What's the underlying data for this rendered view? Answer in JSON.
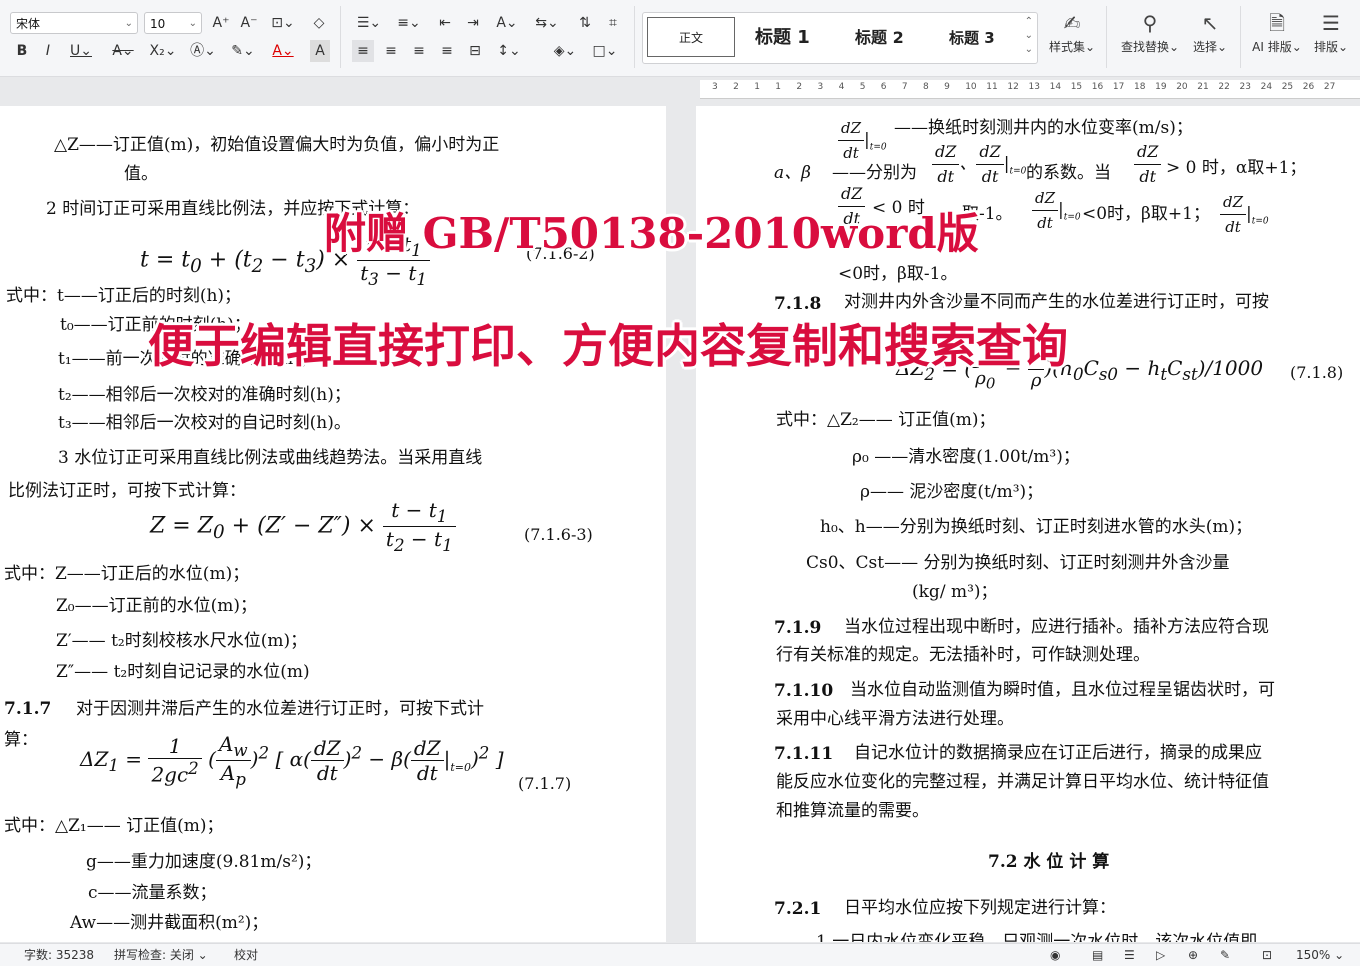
{
  "toolbar": {
    "font_name": "宋体",
    "font_size": "10",
    "styles": [
      "正文",
      "标题 1",
      "标题 2",
      "标题 3"
    ],
    "style_set_label": "样式集",
    "find_replace_label": "查找替换",
    "select_label": "选择",
    "ai_layout_label": "AI 排版",
    "layout_label": "排版"
  },
  "ruler": {
    "ticks": [
      "3",
      "2",
      "1",
      "1",
      "2",
      "3",
      "4",
      "5",
      "6",
      "7",
      "8",
      "9",
      "10",
      "11",
      "12",
      "13",
      "14",
      "15",
      "16",
      "17",
      "18",
      "19",
      "20",
      "21",
      "22",
      "23",
      "24",
      "25",
      "26",
      "27"
    ]
  },
  "banner": {
    "line1": "附赠 GB/T50138-2010word版",
    "line2": "便于编辑直接打印、方便内容复制和搜索查询"
  },
  "left_page": {
    "l1": "△Z——订正值(m)，初始值设置偏大时为负值，偏小时为正",
    "l2": "值。",
    "l3": "2 时间订正可采用直线比例法，并应按下式计算：",
    "eq2_no": "(7.1.6-2)",
    "l4": "式中：t——订正后的时刻(h)；",
    "l5": "t₀——订正前的时刻(h)；",
    "l6": "t₁——前一次校对的准确时刻(h)；",
    "l7": "t₂——相邻后一次校对的准确时刻(h)；",
    "l8": "t₃——相邻后一次校对的自记时刻(h)。",
    "l9": "3 水位订正可采用直线比例法或曲线趋势法。当采用直线",
    "l10": "比例法订正时，可按下式计算：",
    "eq3_no": "(7.1.6-3)",
    "l11": "式中：Z——订正后的水位(m)；",
    "l12": "Z₀——订正前的水位(m)；",
    "l13": "Z′—— t₂时刻校核水尺水位(m)；",
    "l14": "Z″—— t₂时刻自记记录的水位(m)",
    "l15_num": "7.1.7",
    "l15": "对于因测井滞后产生的水位差进行订正时，可按下式计",
    "l16": "算：",
    "eq4_no": "(7.1.7)",
    "l17": "式中：△Z₁—— 订正值(m)；",
    "l18": "g——重力加速度(9.81m/s²)；",
    "l19": "c——流量系数；",
    "l20": "Aw——测井截面积(m²)；"
  },
  "right_page": {
    "r1": "——换纸时刻测井内的水位变率(m/s)；",
    "r2a": "a、β",
    "r2b": "——分别为",
    "r2c": "的系数。当",
    "r2d": "> 0 时，α取+1；",
    "r3a": "< 0 时",
    "r3b": "取-1。",
    "r3c": "<0时，β取+1；",
    "r4": "<0时，β取-1。",
    "r5_num": "7.1.8",
    "r5": "对测井内外含沙量不同而产生的水位差进行订正时，可按",
    "eq_no": "(7.1.8)",
    "r6": "式中：△Z₂—— 订正值(m)；",
    "r7": "ρ₀ ——清水密度(1.00t/m³)；",
    "r8": "ρ——   泥沙密度(t/m³)；",
    "r9": "h₀、h——分别为换纸时刻、订正时刻进水管的水头(m)；",
    "r10": "Cs0、Cst—— 分别为换纸时刻、订正时刻测井外含沙量",
    "r11": "(kg/ m³)；",
    "r12_num": "7.1.9",
    "r12": "当水位过程出现中断时，应进行插补。插补方法应符合现",
    "r13": "行有关标准的规定。无法插补时，可作缺测处理。",
    "r14_num": "7.1.10",
    "r14": "当水位自动监测值为瞬时值，且水位过程呈锯齿状时，可",
    "r15": "采用中心线平滑方法进行处理。",
    "r16_num": "7.1.11",
    "r16": "自记水位计的数据摘录应在订正后进行，摘录的成果应",
    "r17": "能反应水位变化的完整过程，并满足计算日平均水位、统计特征值",
    "r18": "和推算流量的需要。",
    "r19": "7.2 水 位 计 算",
    "r20_num": "7.2.1",
    "r20": "日平均水位应按下列规定进行计算：",
    "r21": "1 一日内水位变化平稳，只观测一次水位时，该次水位值即"
  },
  "status": {
    "word_count": "字数: 35238",
    "spell_check": "拼写检查: 关闭",
    "proofread": "校对",
    "zoom": "150%"
  }
}
